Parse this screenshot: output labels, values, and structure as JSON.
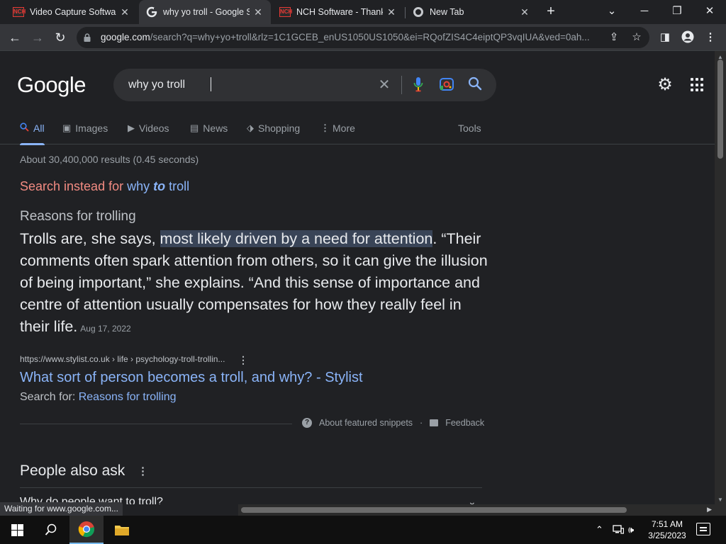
{
  "browser": {
    "tabs": [
      {
        "title": "Video Capture Softwar",
        "favicon": "nch-logo-icon"
      },
      {
        "title": "why yo troll - Google S",
        "favicon": "google-g-icon"
      },
      {
        "title": "NCH Software - Thank",
        "favicon": "nch-logo-icon"
      },
      {
        "title": "New Tab",
        "favicon": "chrome-icon"
      }
    ],
    "url_host": "google.com",
    "url_rest": "/search?q=why+yo+troll&rlz=1C1GCEB_enUS1050US1050&ei=RQofZIS4C4eiptQP3vqIUA&ved=0ah..."
  },
  "google": {
    "logo": "Google",
    "query": "why yo troll",
    "tabs": [
      {
        "label": "All",
        "icon": "search-icon"
      },
      {
        "label": "Images",
        "icon": "image-icon"
      },
      {
        "label": "Videos",
        "icon": "play-icon"
      },
      {
        "label": "News",
        "icon": "news-icon"
      },
      {
        "label": "Shopping",
        "icon": "tag-icon"
      },
      {
        "label": "More",
        "icon": "more-vert-icon"
      }
    ],
    "tools_label": "Tools",
    "stats": "About 30,400,000 results (0.45 seconds)",
    "correction": {
      "prefix": "Search instead for",
      "word1": "why",
      "word2": "to",
      "word3": "troll"
    },
    "snippet": {
      "heading": "Reasons for trolling",
      "pre": "Trolls are, she says, ",
      "highlight": "most likely driven by a need for attention",
      "post": ". “Their comments often spark attention from others, so it can give the illusion of being important,” she explains. “And this sense of importance and centre of attention usually compensates for how they really feel in their life.",
      "date": "Aug 17, 2022"
    },
    "result": {
      "cite": "https://www.stylist.co.uk › life › psychology-troll-trollin...",
      "title": "What sort of person becomes a troll, and why? - Stylist",
      "search_for_label": "Search for:",
      "search_for_link": "Reasons for trolling"
    },
    "about_snippets": "About featured snippets",
    "feedback": "Feedback",
    "people_also_ask": "People also ask",
    "paa_first": "Why do people want to troll?"
  },
  "status_bar": "Waiting for www.google.com...",
  "taskbar": {
    "time": "7:51 AM",
    "date": "3/25/2023"
  },
  "colors": {
    "link": "#8ab4f8",
    "correction": "#f28b82",
    "highlight": "#394457",
    "background": "#202124"
  }
}
